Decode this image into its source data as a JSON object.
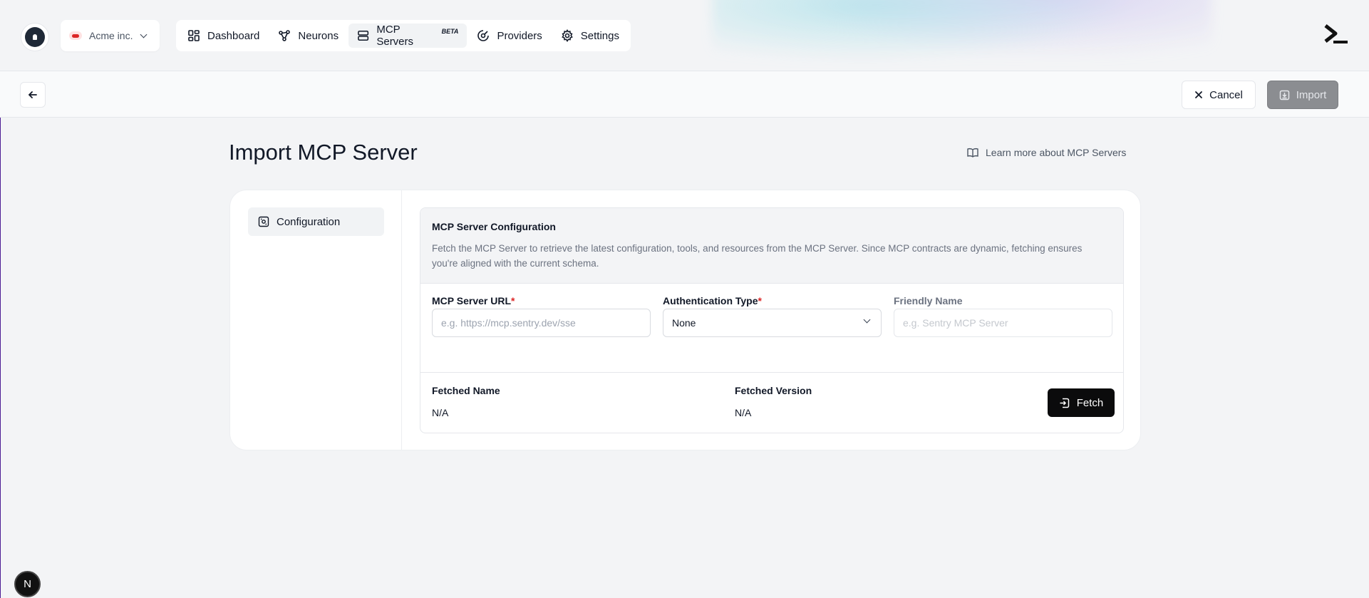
{
  "header": {
    "org_name": "Acme inc.",
    "nav": [
      {
        "label": "Dashboard",
        "icon": "dashboard-icon"
      },
      {
        "label": "Neurons",
        "icon": "neurons-icon"
      },
      {
        "label": "MCP Servers",
        "icon": "server-icon",
        "badge": "BETA",
        "active": true
      },
      {
        "label": "Providers",
        "icon": "providers-icon"
      },
      {
        "label": "Settings",
        "icon": "gear-icon"
      }
    ]
  },
  "actions": {
    "cancel_label": "Cancel",
    "import_label": "Import"
  },
  "page": {
    "title": "Import MCP Server",
    "learn_more": "Learn more about MCP Servers"
  },
  "sidebar": {
    "items": [
      {
        "label": "Configuration",
        "icon": "configuration-icon"
      }
    ]
  },
  "config": {
    "title": "MCP Server Configuration",
    "description": "Fetch the MCP Server to retrieve the latest configuration, tools, and resources from the MCP Server. Since MCP contracts are dynamic, fetching ensures you're aligned with the current schema.",
    "url_label": "MCP Server URL",
    "url_placeholder": "e.g. https://mcp.sentry.dev/sse",
    "auth_label": "Authentication Type",
    "auth_value": "None",
    "friendly_label": "Friendly Name",
    "friendly_placeholder": "e.g. Sentry MCP Server",
    "required_mark": "*",
    "fetched_name_label": "Fetched Name",
    "fetched_name_value": "N/A",
    "fetched_version_label": "Fetched Version",
    "fetched_version_value": "N/A",
    "fetch_label": "Fetch"
  },
  "dev_badge": "N",
  "colors": {
    "primary": "#0b0b0c",
    "required": "#dc2626",
    "disabled_button": "#8b8d91"
  }
}
